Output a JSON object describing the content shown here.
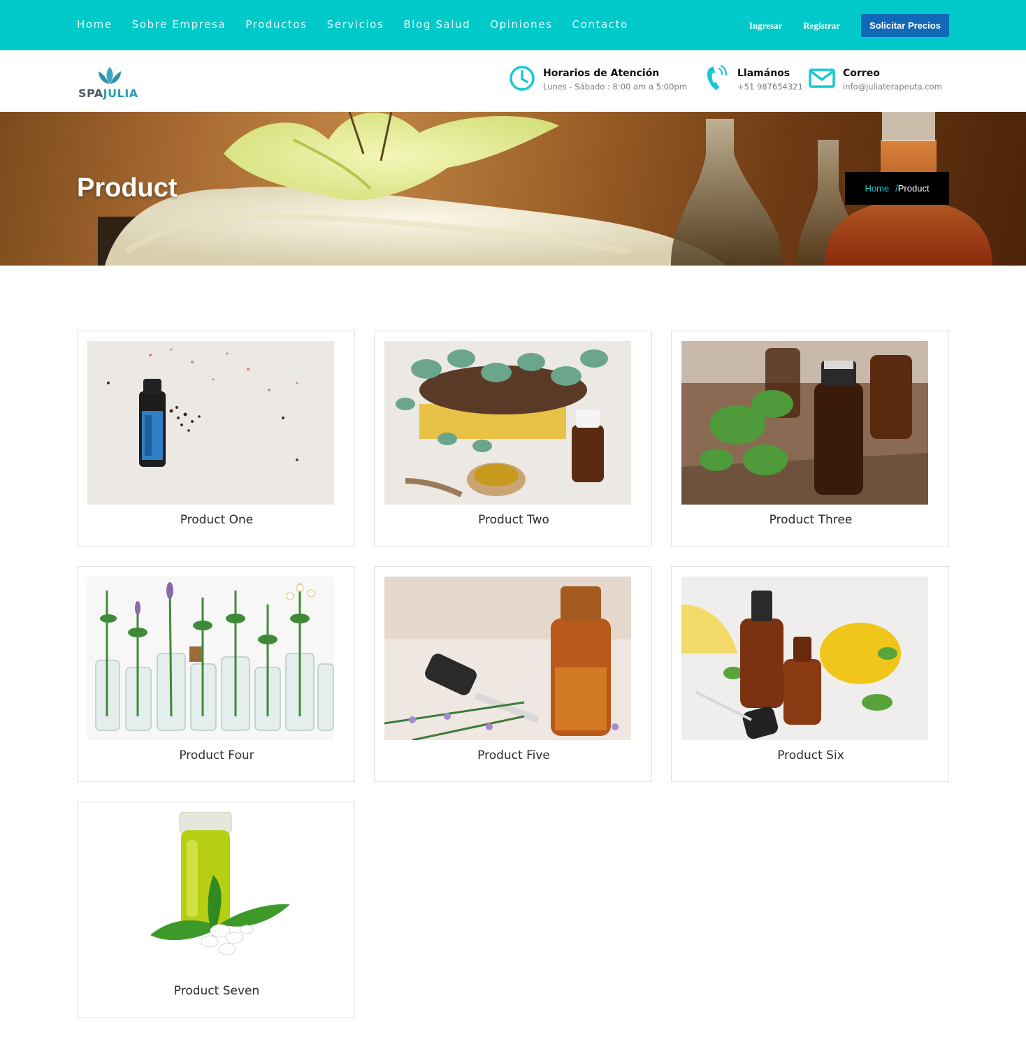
{
  "nav": {
    "links": [
      "Home",
      "Sobre Empresa",
      "Productos",
      "Servicios",
      "Blog Salud",
      "Opiniones",
      "Contacto"
    ],
    "login": "Ingresar",
    "register": "Registrar",
    "cta": "Solicitar Precios",
    "bg_color": "#00c9c9",
    "cta_color": "#1068b6"
  },
  "logo": {
    "spa": "SPA",
    "julia": "JULIA",
    "icon": "lotus-icon"
  },
  "contact": {
    "hours": {
      "title": "Horarios de Atención",
      "value": "Lunes - Sábado : 8:00 am a 5:00pm",
      "icon": "clock-icon"
    },
    "phone": {
      "title": "Llamános",
      "value": "+51 987654321",
      "icon": "phone-icon"
    },
    "email": {
      "title": "Correo",
      "value": "info@juliaterapeuta.com",
      "icon": "envelope-icon"
    },
    "accent_color": "#16c9d1"
  },
  "banner": {
    "title": "Product",
    "breadcrumb": {
      "home": "Home",
      "separator": "/",
      "current": "Product"
    }
  },
  "products": [
    {
      "name": "Product One"
    },
    {
      "name": "Product Two"
    },
    {
      "name": "Product Three"
    },
    {
      "name": "Product Four"
    },
    {
      "name": "Product Five"
    },
    {
      "name": "Product Six"
    },
    {
      "name": "Product Seven"
    }
  ]
}
